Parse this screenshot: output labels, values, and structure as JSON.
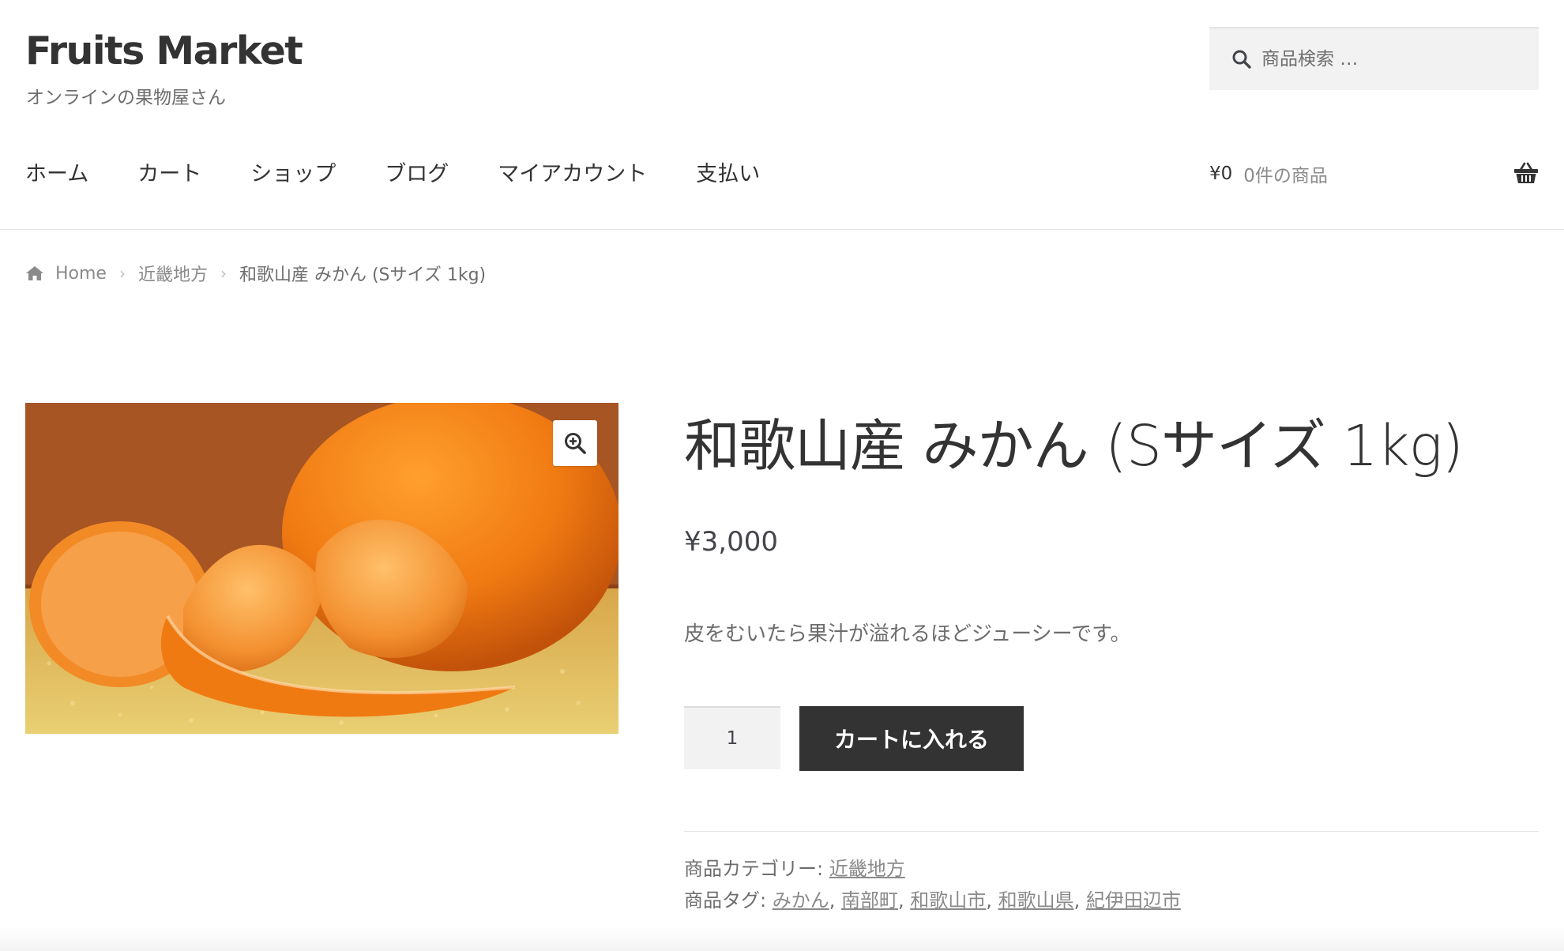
{
  "site": {
    "title": "Fruits Market",
    "tagline": "オンラインの果物屋さん"
  },
  "search": {
    "placeholder": "商品検索 …",
    "icon": "search-icon"
  },
  "nav": {
    "items": [
      {
        "label": "ホーム"
      },
      {
        "label": "カート"
      },
      {
        "label": "ショップ"
      },
      {
        "label": "ブログ"
      },
      {
        "label": "マイアカウント"
      },
      {
        "label": "支払い"
      }
    ]
  },
  "cart": {
    "amount": "¥0",
    "count_text": "0件の商品",
    "icon": "basket-icon"
  },
  "breadcrumb": {
    "home": "Home",
    "category": "近畿地方",
    "current": "和歌山産 みかん (Sサイズ 1kg)"
  },
  "product": {
    "title": "和歌山産 みかん (Sサイズ 1kg)",
    "price": "¥3,000",
    "description": "皮をむいたら果汁が溢れるほどジューシーです。",
    "quantity": "1",
    "add_to_cart_label": "カートに入れる",
    "image_icon": "zoom-in-icon"
  },
  "meta": {
    "categories_label": "商品カテゴリー:",
    "categories": [
      {
        "label": "近畿地方"
      }
    ],
    "tags_label": "商品タグ:",
    "tags": [
      {
        "label": "みかん"
      },
      {
        "label": "南部町"
      },
      {
        "label": "和歌山市"
      },
      {
        "label": "和歌山県"
      },
      {
        "label": "紀伊田辺市"
      }
    ],
    "separator": ","
  },
  "colors": {
    "button_bg": "#333333",
    "input_bg": "#f2f2f2",
    "text": "#43454b",
    "muted": "#6d6d6d",
    "orange": "#f07a12"
  }
}
